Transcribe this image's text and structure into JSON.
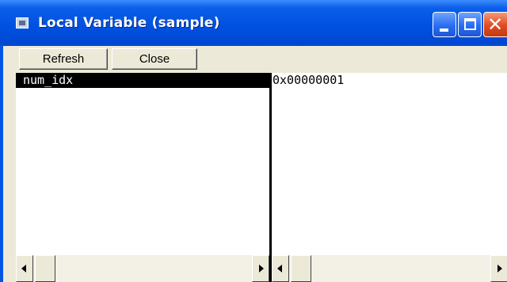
{
  "window": {
    "title": "Local Variable (sample)",
    "icons": {
      "app": "window-app-icon",
      "minimize": "minimize-icon",
      "maximize": "maximize-icon",
      "close": "close-icon"
    },
    "close_glyph": "✕"
  },
  "toolbar": {
    "refresh_label": "Refresh",
    "close_label": "Close"
  },
  "variables": {
    "rows": [
      {
        "name": "num_idx",
        "value": "0x00000001",
        "selected": true
      }
    ]
  },
  "colors": {
    "titlebar": "#0050e0",
    "selection": "#000000",
    "face": "#ece9d8"
  }
}
